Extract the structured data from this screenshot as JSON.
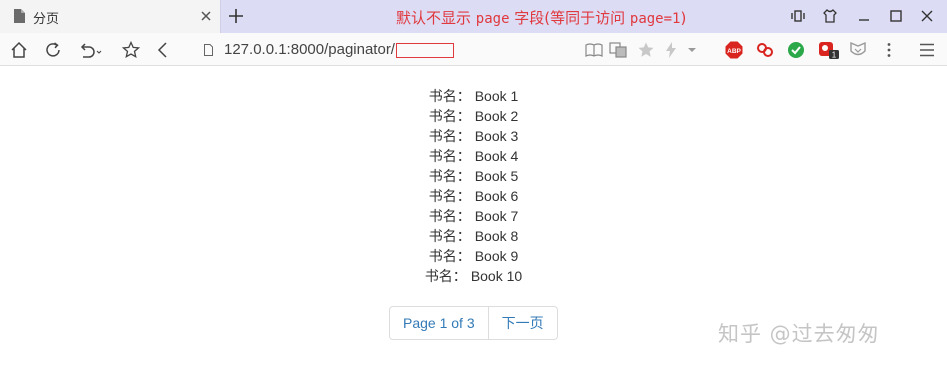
{
  "tab": {
    "title": "分页"
  },
  "annotation": {
    "text_before": "默认不显示 ",
    "code1": "page",
    "text_middle": " 字段(等同于访问 ",
    "code2": "page=1",
    "text_after": ")"
  },
  "address_bar": {
    "url": "127.0.0.1:8000/paginator/"
  },
  "extensions": {
    "adblock_label": "ABP",
    "badge_count": "1"
  },
  "books": {
    "label": "书名：",
    "items": [
      "Book 1",
      "Book 2",
      "Book 3",
      "Book 4",
      "Book 5",
      "Book 6",
      "Book 7",
      "Book 8",
      "Book 9",
      "Book 10"
    ]
  },
  "pagination": {
    "current": "Page 1 of 3",
    "next": "下一页"
  },
  "watermark": {
    "text": "知乎 @过去匆匆"
  },
  "colors": {
    "annotation": "#e0393e",
    "link": "#337ab7",
    "tabbar": "#dcdcf5"
  }
}
